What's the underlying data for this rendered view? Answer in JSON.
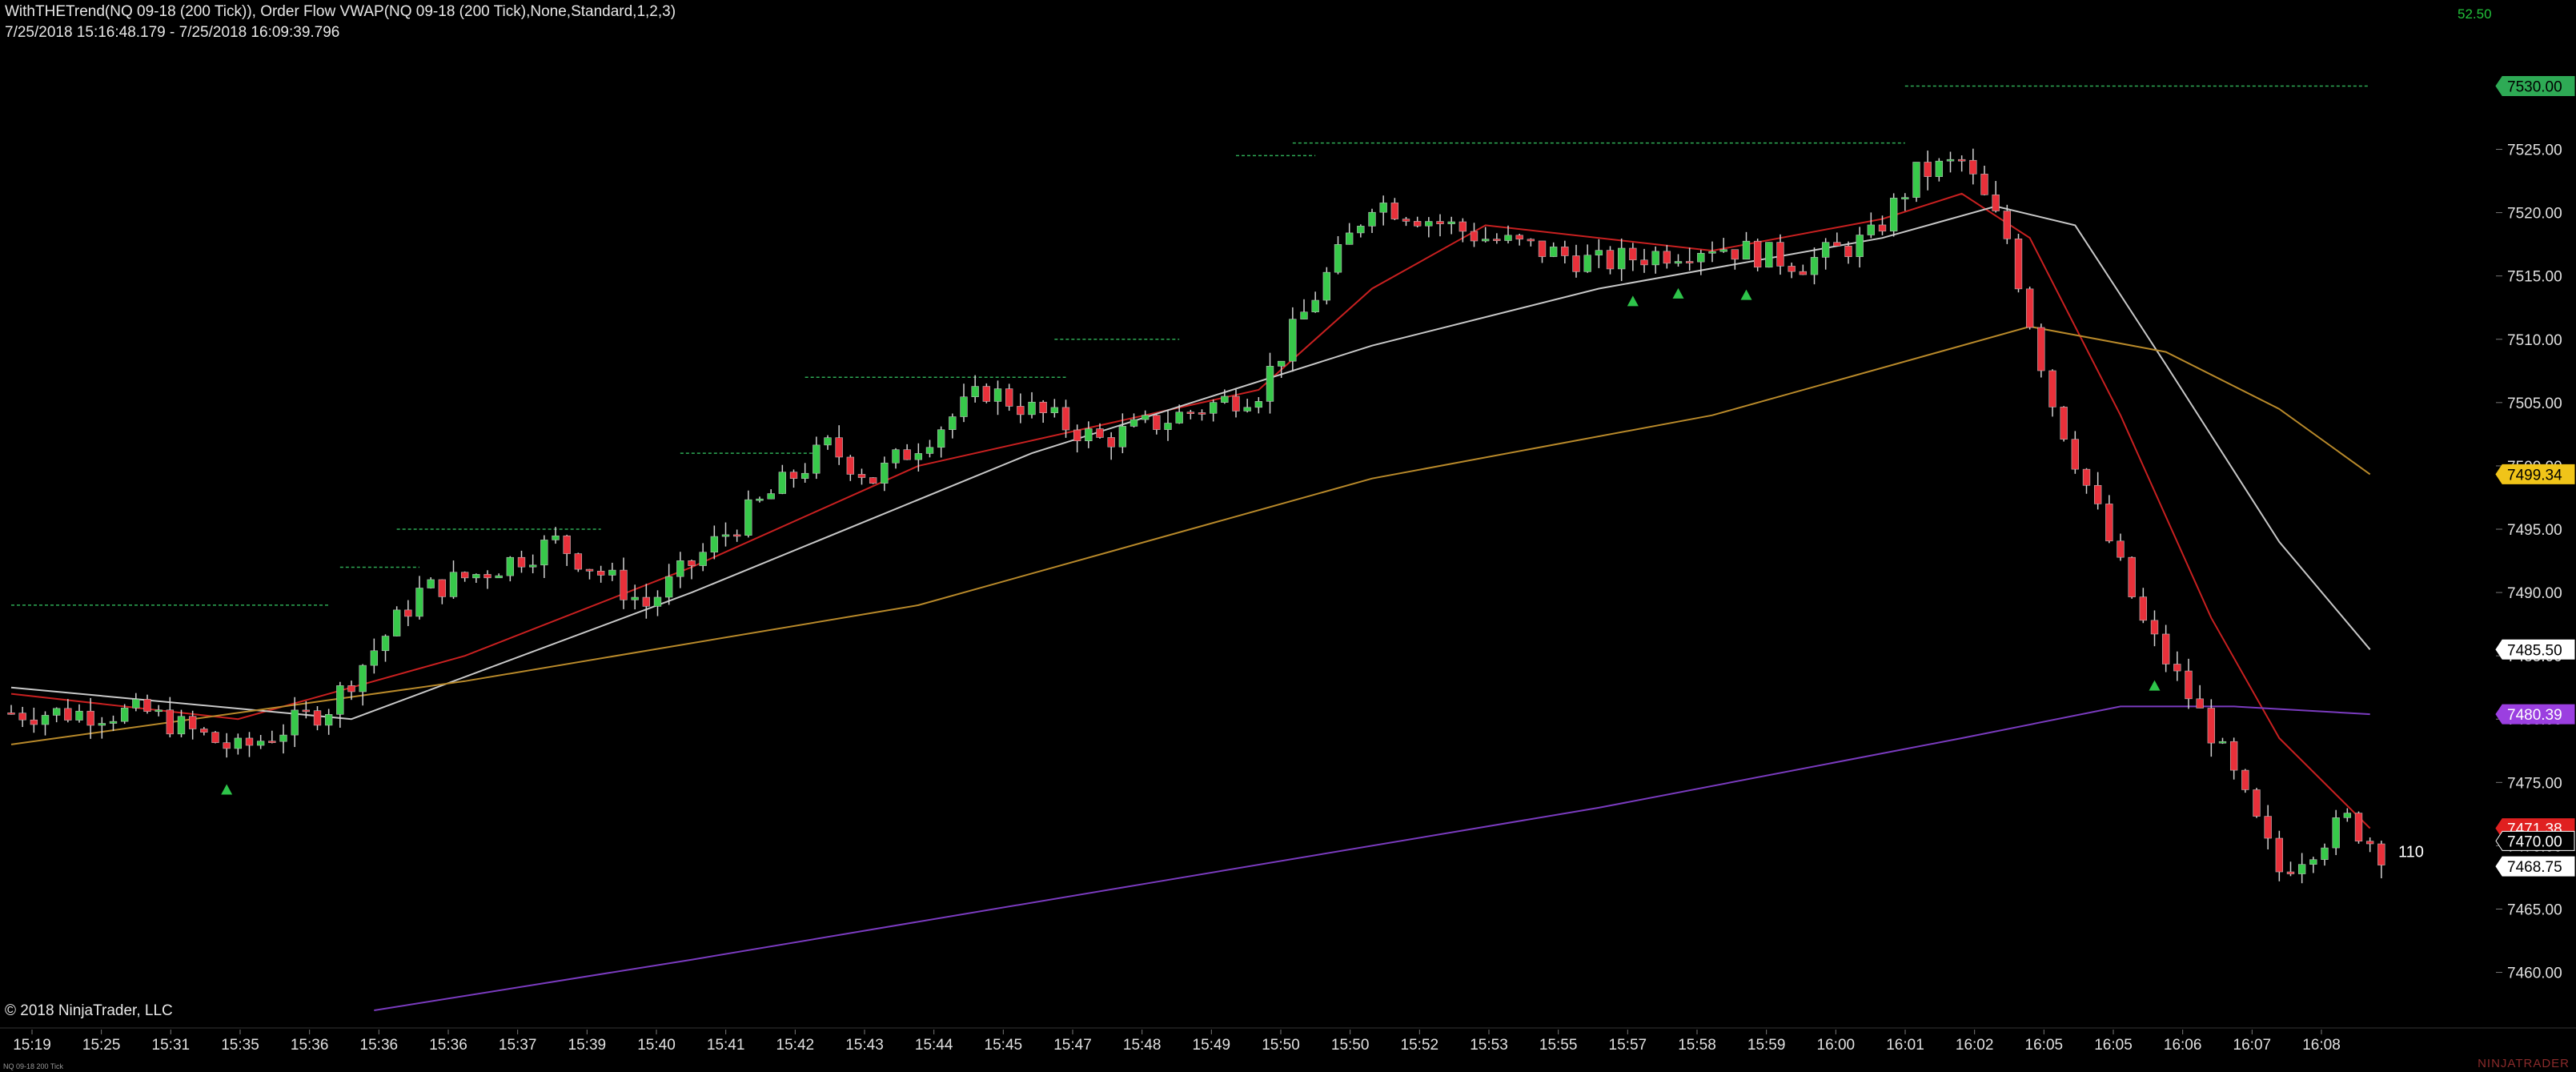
{
  "header": {
    "indicators": "WithTHETrend(NQ 09-18 (200 Tick)), Order Flow VWAP(NQ 09-18 (200 Tick),None,Standard,1,2,3)",
    "range": "7/25/2018 15:16:48.179 - 7/25/2018 16:09:39.796",
    "tick_value": "52.50"
  },
  "footer": {
    "copyright": "© 2018 NinjaTrader, LLC",
    "instrument": "NQ 09-18 200 Tick",
    "brand": "NINJATRADER"
  },
  "bar_counter": "110",
  "colors": {
    "background": "#000000",
    "up_candle": "#37c94a",
    "down_candle": "#e8303a",
    "wick": "#d0d0d0",
    "fast_ma": "#c82020",
    "mid_ma": "#c8c8c8",
    "slow_ma": "#b8892a",
    "vwap": "#7a3bbf",
    "level_line": "#2eaa55"
  },
  "chart_data": {
    "type": "candlestick",
    "title": "",
    "ylim": [
      7457,
      7533
    ],
    "y_ticks": [
      7460.0,
      7465.0,
      7470.0,
      7475.0,
      7480.0,
      7485.0,
      7490.0,
      7495.0,
      7500.0,
      7505.0,
      7510.0,
      7515.0,
      7520.0,
      7525.0,
      7530.0
    ],
    "x_tick_labels": [
      "15:19",
      "15:25",
      "15:31",
      "15:35",
      "15:36",
      "15:36",
      "15:36",
      "15:37",
      "15:39",
      "15:40",
      "15:41",
      "15:42",
      "15:43",
      "15:44",
      "15:45",
      "15:47",
      "15:48",
      "15:49",
      "15:50",
      "15:50",
      "15:52",
      "15:53",
      "15:55",
      "15:57",
      "15:58",
      "15:59",
      "16:00",
      "16:01",
      "16:02",
      "16:05",
      "16:05",
      "16:06",
      "16:07",
      "16:08"
    ],
    "bar_count": 210,
    "close_path": [
      [
        0,
        7480.5
      ],
      [
        12,
        7480.5
      ],
      [
        20,
        7477.5
      ],
      [
        28,
        7481.0
      ],
      [
        36,
        7490.0
      ],
      [
        42,
        7491.75
      ],
      [
        48,
        7494.0
      ],
      [
        56,
        7489.0
      ],
      [
        64,
        7495.5
      ],
      [
        72,
        7501.5
      ],
      [
        76,
        7499.0
      ],
      [
        86,
        7506.0
      ],
      [
        96,
        7502.0
      ],
      [
        110,
        7506.0
      ],
      [
        120,
        7521.0
      ],
      [
        130,
        7518.0
      ],
      [
        140,
        7516.0
      ],
      [
        150,
        7517.5
      ],
      [
        158,
        7516.0
      ],
      [
        164,
        7518.0
      ],
      [
        168,
        7523.0
      ],
      [
        172,
        7524.0
      ],
      [
        176,
        7518.0
      ],
      [
        180,
        7505.0
      ],
      [
        188,
        7487.5
      ],
      [
        194,
        7479.0
      ],
      [
        200,
        7468.0
      ],
      [
        206,
        7472.0
      ],
      [
        210,
        7468.75
      ]
    ],
    "overlays": [
      {
        "name": "fast",
        "points": [
          [
            0,
            7482.0
          ],
          [
            20,
            7480.0
          ],
          [
            40,
            7485.0
          ],
          [
            60,
            7492.0
          ],
          [
            80,
            7500.0
          ],
          [
            110,
            7506.0
          ],
          [
            120,
            7514.0
          ],
          [
            130,
            7519.0
          ],
          [
            150,
            7517.0
          ],
          [
            165,
            7519.5
          ],
          [
            172,
            7521.5
          ],
          [
            178,
            7518.0
          ],
          [
            186,
            7504.0
          ],
          [
            194,
            7488.0
          ],
          [
            200,
            7478.5
          ],
          [
            208,
            7471.38
          ]
        ]
      },
      {
        "name": "mid",
        "points": [
          [
            0,
            7482.5
          ],
          [
            30,
            7480.0
          ],
          [
            60,
            7490.0
          ],
          [
            90,
            7501.0
          ],
          [
            120,
            7509.5
          ],
          [
            140,
            7514.0
          ],
          [
            165,
            7518.0
          ],
          [
            175,
            7520.5
          ],
          [
            182,
            7519.0
          ],
          [
            190,
            7508.0
          ],
          [
            200,
            7494.0
          ],
          [
            208,
            7485.5
          ]
        ]
      },
      {
        "name": "slow",
        "points": [
          [
            0,
            7478.0
          ],
          [
            40,
            7483.0
          ],
          [
            80,
            7489.0
          ],
          [
            120,
            7499.0
          ],
          [
            150,
            7504.0
          ],
          [
            170,
            7509.0
          ],
          [
            178,
            7511.0
          ],
          [
            190,
            7509.0
          ],
          [
            200,
            7504.5
          ],
          [
            208,
            7499.34
          ]
        ]
      },
      {
        "name": "vwap",
        "points": [
          [
            32,
            7457.0
          ],
          [
            60,
            7461.0
          ],
          [
            100,
            7467.0
          ],
          [
            140,
            7473.0
          ],
          [
            172,
            7478.5
          ],
          [
            186,
            7481.0
          ],
          [
            196,
            7481.0
          ],
          [
            208,
            7480.39
          ]
        ]
      }
    ],
    "levels": [
      {
        "price": 7489.0,
        "from": 0,
        "to": 28
      },
      {
        "price": 7492.0,
        "from": 29,
        "to": 36
      },
      {
        "price": 7495.0,
        "from": 34,
        "to": 52
      },
      {
        "price": 7501.0,
        "from": 59,
        "to": 71
      },
      {
        "price": 7507.0,
        "from": 70,
        "to": 93
      },
      {
        "price": 7510.0,
        "from": 92,
        "to": 103
      },
      {
        "price": 7524.5,
        "from": 108,
        "to": 115
      },
      {
        "price": 7525.5,
        "from": 113,
        "to": 167
      },
      {
        "price": 7530.0,
        "from": 167,
        "to": 208
      }
    ],
    "signal_markers": [
      19,
      143,
      147,
      153,
      189
    ],
    "price_labels": [
      {
        "text": "7530.00",
        "price": 7530.0,
        "bg": "#2eaa55",
        "fg": "#000000"
      },
      {
        "text": "7499.34",
        "price": 7499.34,
        "bg": "#f0c419",
        "fg": "#000000"
      },
      {
        "text": "7485.50",
        "price": 7485.5,
        "bg": "#ffffff",
        "fg": "#000000"
      },
      {
        "text": "7480.39",
        "price": 7480.39,
        "bg": "#9b3fe0",
        "fg": "#ffffff"
      },
      {
        "text": "7471.38",
        "price": 7471.38,
        "bg": "#e02020",
        "fg": "#ffffff"
      },
      {
        "text": "7470.00",
        "price": 7470.0,
        "bg": "#000000",
        "fg": "#ffffff"
      },
      {
        "text": "7468.75",
        "price": 7468.75,
        "bg": "#ffffff",
        "fg": "#000000"
      }
    ]
  }
}
